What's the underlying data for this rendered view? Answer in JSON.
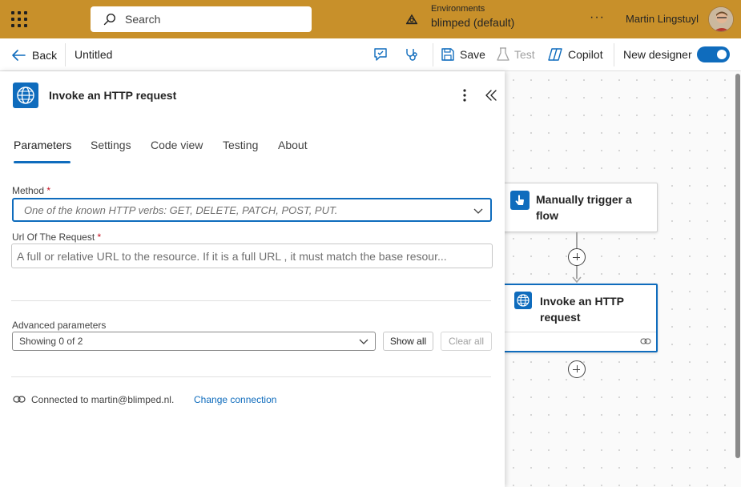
{
  "topbar": {
    "search_placeholder": "Search",
    "environment_label": "Environments",
    "environment_name": "blimped (default)",
    "more": "···",
    "user_name": "Martin Lingstuyl"
  },
  "cmdbar": {
    "back_label": "Back",
    "flow_title": "Untitled",
    "save_label": "Save",
    "test_label": "Test",
    "copilot_label": "Copilot",
    "new_designer_label": "New designer",
    "new_designer_on": true
  },
  "panel": {
    "title": "Invoke an HTTP request",
    "tabs": [
      {
        "label": "Parameters",
        "active": true
      },
      {
        "label": "Settings",
        "active": false
      },
      {
        "label": "Code view",
        "active": false
      },
      {
        "label": "Testing",
        "active": false
      },
      {
        "label": "About",
        "active": false
      }
    ],
    "method": {
      "label": "Method",
      "required": "*",
      "placeholder": "One of the known HTTP verbs: GET, DELETE, PATCH, POST, PUT."
    },
    "url": {
      "label": "Url Of The Request",
      "required": "*",
      "placeholder": "A full or relative URL to the resource. If it is a full URL , it must match the base resour..."
    },
    "advanced": {
      "label": "Advanced parameters",
      "value": "Showing 0 of 2",
      "show_all": "Show all",
      "clear_all": "Clear all"
    },
    "connection": {
      "text": "Connected to martin@blimped.nl.",
      "change_link": "Change connection"
    }
  },
  "canvas": {
    "nodes": [
      {
        "label": "Manually trigger a flow"
      },
      {
        "label": "Invoke an HTTP request"
      }
    ]
  },
  "colors": {
    "topbar": "#c8902a",
    "accent": "#0f6cbd",
    "required": "#c50f1f"
  }
}
